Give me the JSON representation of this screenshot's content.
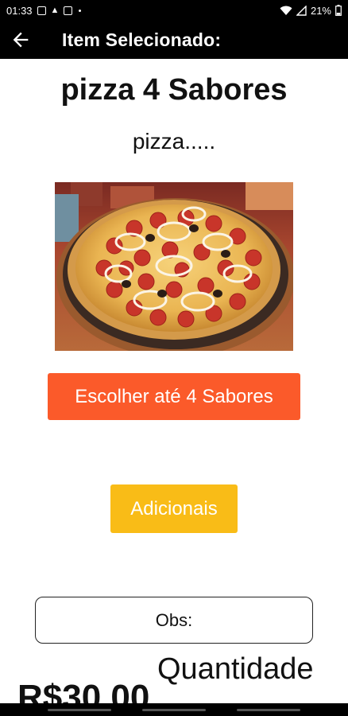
{
  "status_bar": {
    "time": "01:33",
    "battery": "21%",
    "icons": [
      "notification-icon",
      "warning-icon",
      "app-icon",
      "wifi-icon",
      "signal-icon",
      "battery-icon"
    ]
  },
  "app_bar": {
    "back_icon": "arrow-back-icon",
    "title": "Item Selecionado:"
  },
  "item": {
    "name": "pizza 4 Sabores",
    "description": "pizza.....",
    "image": "pizza-photo"
  },
  "actions": {
    "flavors_label": "Escolher até 4 Sabores",
    "extras_label": "Adicionais"
  },
  "obs": {
    "label": "Obs:"
  },
  "quantity": {
    "label": "Quantidade"
  },
  "price": {
    "value": "R$30,00"
  },
  "colors": {
    "bar": "#000000",
    "flavors_button": "#fb5a2a",
    "extras_button": "#f9bc17"
  }
}
